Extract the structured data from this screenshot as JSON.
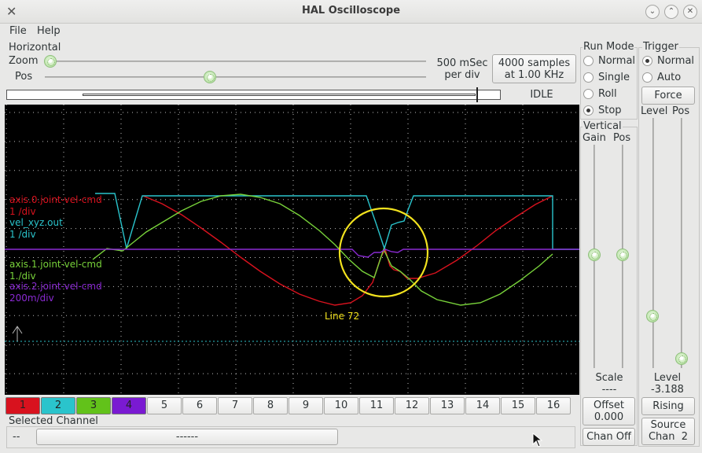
{
  "window": {
    "title": "HAL Oscilloscope",
    "close_glyph": "✕",
    "minimize_glyph": "⌄",
    "maximize_glyph": "⌃",
    "dismiss_glyph": "✕"
  },
  "menu": {
    "file": "File",
    "help": "Help"
  },
  "horizontal": {
    "title": "Horizontal",
    "zoom_label": "Zoom",
    "pos_label": "Pos",
    "rate_line1": "500 mSec",
    "rate_line2": "per div",
    "samples_line1": "4000 samples",
    "samples_line2": "at 1.00 KHz",
    "zoom_level": 0.0,
    "pos_level": 0.43,
    "status": "IDLE"
  },
  "run_mode": {
    "title": "Run Mode",
    "options": [
      "Normal",
      "Single",
      "Roll",
      "Stop"
    ],
    "selected": "Stop"
  },
  "trigger": {
    "title": "Trigger",
    "options": [
      "Normal",
      "Auto"
    ],
    "selected": "Normal",
    "force_label": "Force",
    "level_header": "Level",
    "pos_header": "Pos",
    "level_title": "Level",
    "level_value": "-3.188",
    "edge_button": "Rising",
    "source_line1": "Source",
    "source_line2": "Chan  2"
  },
  "vertical": {
    "title": "Vertical",
    "gain_header": "Gain",
    "pos_header": "Pos",
    "scale_title": "Scale",
    "scale_value": "----",
    "offset_line1": "Offset",
    "offset_line2": "0.000",
    "chan_off": "Chan Off"
  },
  "scope": {
    "annotation": "Line 72",
    "labels": [
      {
        "name": "axis.0.joint-vel-cmd",
        "scale": "1 /div",
        "color": "#d8121e"
      },
      {
        "name": "vel_xyz.out",
        "scale": "1 /div",
        "color": "#2ac4cc"
      },
      {
        "name": "axis.1.joint-vel-cmd",
        "scale": "1./div",
        "color": "#78d23a"
      },
      {
        "name": "axis.2.joint-vel-cmd",
        "scale": "200m/div",
        "color": "#8a2ad2"
      }
    ],
    "colors": {
      "background": "#000000",
      "grid": "#ffffff",
      "highlight": "#f2e21e",
      "baseline": "#2ac4cc"
    }
  },
  "channels": [
    {
      "n": "1",
      "color": "#d8121e"
    },
    {
      "n": "2",
      "color": "#2ac4cc"
    },
    {
      "n": "3",
      "color": "#62c21a"
    },
    {
      "n": "4",
      "color": "#7a1ad2"
    },
    {
      "n": "5"
    },
    {
      "n": "6"
    },
    {
      "n": "7"
    },
    {
      "n": "8"
    },
    {
      "n": "9"
    },
    {
      "n": "10"
    },
    {
      "n": "11"
    },
    {
      "n": "12"
    },
    {
      "n": "13"
    },
    {
      "n": "14"
    },
    {
      "n": "15"
    },
    {
      "n": "16"
    }
  ],
  "selected_channel": {
    "title": "Selected Channel",
    "left_value": "--",
    "bar_value": "------"
  }
}
